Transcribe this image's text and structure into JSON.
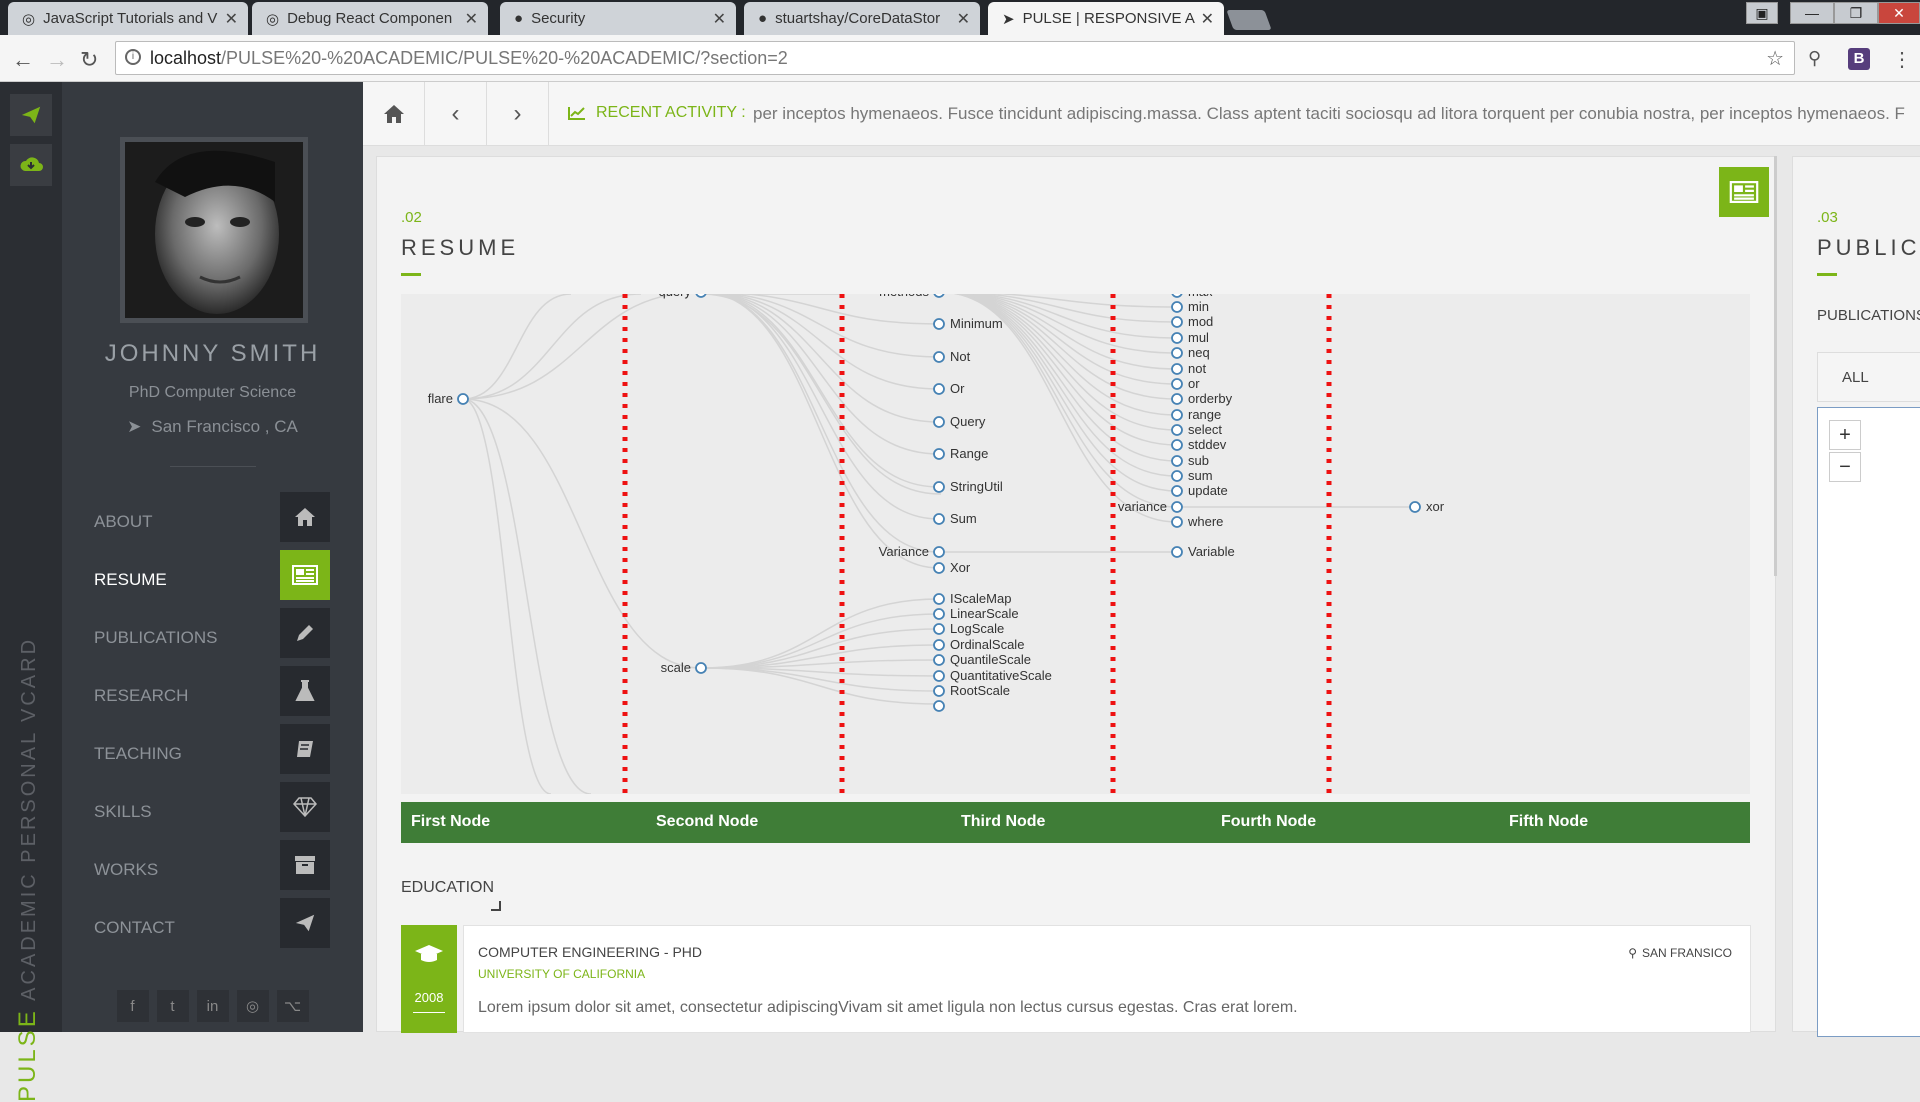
{
  "browser": {
    "tabs": [
      {
        "label": "JavaScript Tutorials and V",
        "icon": "glasses-icon"
      },
      {
        "label": "Debug React Componen",
        "icon": "glasses-icon"
      },
      {
        "label": "Security",
        "icon": "github-icon"
      },
      {
        "label": "stuartshay/CoreDataStor",
        "icon": "github-icon"
      },
      {
        "label": "PULSE | RESPONSIVE AC",
        "icon": "cursor-icon"
      }
    ],
    "url_host": "localhost",
    "url_path": "/PULSE%20-%20ACADEMIC/PULSE%20-%20ACADEMIC/?section=2",
    "ext_label": "B"
  },
  "vertical_brand": {
    "strong": "PULSE",
    "rest": "ACADEMIC PERSONAL VCARD"
  },
  "profile": {
    "name": "JOHNNY SMITH",
    "role": "PhD Computer Science",
    "location": "San Francisco , CA"
  },
  "menu": [
    {
      "label": "ABOUT",
      "icon": "home-icon",
      "active": false
    },
    {
      "label": "RESUME",
      "icon": "newspaper-icon",
      "active": true
    },
    {
      "label": "PUBLICATIONS",
      "icon": "pencil-icon",
      "active": false
    },
    {
      "label": "RESEARCH",
      "icon": "flask-icon",
      "active": false
    },
    {
      "label": "TEACHING",
      "icon": "book-icon",
      "active": false
    },
    {
      "label": "SKILLS",
      "icon": "diamond-icon",
      "active": false
    },
    {
      "label": "WORKS",
      "icon": "archive-icon",
      "active": false
    },
    {
      "label": "CONTACT",
      "icon": "paper-plane-icon",
      "active": false
    }
  ],
  "social": [
    "f",
    "t",
    "in",
    "◎",
    "⌥"
  ],
  "activity": {
    "label": "RECENT ACTIVITY :",
    "text": "per inceptos hymenaeos. Fusce tincidunt adipiscing.massa. Class aptent taciti sociosqu ad litora torquent per conubia nostra, per inceptos hymenaeos. F"
  },
  "resume": {
    "number": ".02",
    "title": "RESUME",
    "tree": {
      "col1": [
        "flare"
      ],
      "col2": [
        "query",
        "scale"
      ],
      "col3_top": "methods",
      "col3": [
        "Minimum",
        "Not",
        "Or",
        "Query",
        "Range",
        "StringUtil",
        "Sum",
        "Variance",
        "Xor",
        "IScaleMap",
        "LinearScale",
        "LogScale",
        "OrdinalScale",
        "QuantileScale",
        "QuantitativeScale",
        "RootScale"
      ],
      "col4_top": "max",
      "col4": [
        "min",
        "mod",
        "mul",
        "neq",
        "not",
        "or",
        "orderby",
        "range",
        "select",
        "stddev",
        "sub",
        "sum",
        "update",
        "variance",
        "where",
        "Variable"
      ],
      "col5": [
        "xor"
      ]
    },
    "legend": [
      "First Node",
      "Second Node",
      "Third Node",
      "Fourth Node",
      "Fifth Node"
    ],
    "education": {
      "heading": "EDUCATION",
      "year": "2008",
      "degree": "COMPUTER ENGINEERING - PHD",
      "university": "UNIVERSITY OF CALIFORNIA",
      "location": "SAN FRANSICO",
      "description": "Lorem ipsum dolor sit amet, consectetur adipiscingVivam sit amet ligula non lectus cursus egestas. Cras erat lorem."
    }
  },
  "publications": {
    "number": ".03",
    "title": "PUBLICA",
    "label": "PUBLICATIONS",
    "filter_all": "ALL",
    "zoom_in": "+",
    "zoom_out": "−"
  }
}
